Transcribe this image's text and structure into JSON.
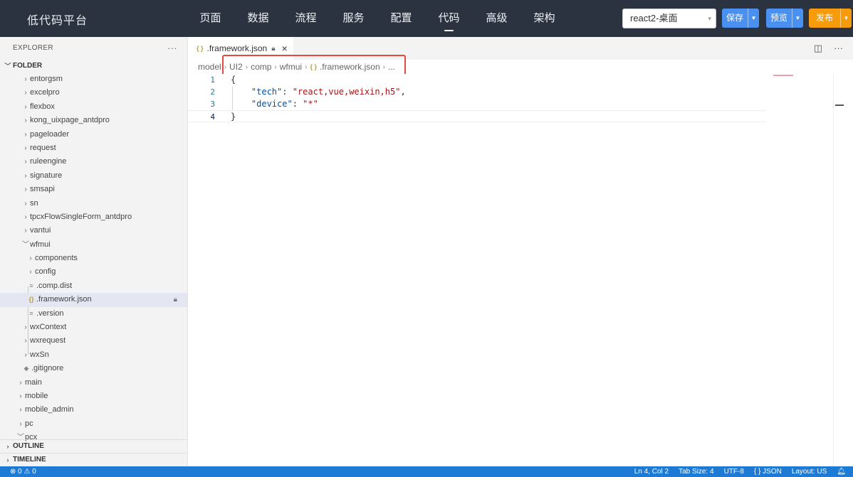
{
  "brand": "低代码平台",
  "nav": [
    "页面",
    "数据",
    "流程",
    "服务",
    "配置",
    "代码",
    "高级",
    "架构"
  ],
  "nav_active": "代码",
  "target_select": "react2-桌面",
  "buttons": {
    "save": "保存",
    "preview": "预览",
    "publish": "发布"
  },
  "explorer": {
    "title": "EXPLORER",
    "more": "···",
    "folder_label": "FOLDER",
    "outline_label": "OUTLINE",
    "timeline_label": "TIMELINE",
    "tree": [
      {
        "label": "entorgsm",
        "indent": 2,
        "kind": "folder"
      },
      {
        "label": "excelpro",
        "indent": 2,
        "kind": "folder"
      },
      {
        "label": "flexbox",
        "indent": 2,
        "kind": "folder"
      },
      {
        "label": "kong_uixpage_antdpro",
        "indent": 2,
        "kind": "folder"
      },
      {
        "label": "pageloader",
        "indent": 2,
        "kind": "folder"
      },
      {
        "label": "request",
        "indent": 2,
        "kind": "folder"
      },
      {
        "label": "ruleengine",
        "indent": 2,
        "kind": "folder"
      },
      {
        "label": "signature",
        "indent": 2,
        "kind": "folder"
      },
      {
        "label": "smsapi",
        "indent": 2,
        "kind": "folder"
      },
      {
        "label": "sn",
        "indent": 2,
        "kind": "folder"
      },
      {
        "label": "tpcxFlowSingleForm_antdpro",
        "indent": 2,
        "kind": "folder"
      },
      {
        "label": "vantui",
        "indent": 2,
        "kind": "folder"
      },
      {
        "label": "wfmui",
        "indent": 2,
        "kind": "folder-open"
      },
      {
        "label": "components",
        "indent": 3,
        "kind": "folder"
      },
      {
        "label": "config",
        "indent": 3,
        "kind": "folder"
      },
      {
        "label": ".comp.dist",
        "indent": 3,
        "kind": "file"
      },
      {
        "label": ".framework.json",
        "indent": 3,
        "kind": "json",
        "selected": true,
        "locked": true
      },
      {
        "label": ".version",
        "indent": 3,
        "kind": "file"
      },
      {
        "label": "wxContext",
        "indent": 2,
        "kind": "folder"
      },
      {
        "label": "wxrequest",
        "indent": 2,
        "kind": "folder"
      },
      {
        "label": "wxSn",
        "indent": 2,
        "kind": "folder"
      },
      {
        "label": ".gitignore",
        "indent": 2,
        "kind": "git"
      },
      {
        "label": "main",
        "indent": 1,
        "kind": "folder"
      },
      {
        "label": "mobile",
        "indent": 1,
        "kind": "folder"
      },
      {
        "label": "mobile_admin",
        "indent": 1,
        "kind": "folder"
      },
      {
        "label": "pc",
        "indent": 1,
        "kind": "folder"
      },
      {
        "label": "pcx",
        "indent": 1,
        "kind": "folder-open"
      }
    ]
  },
  "editor": {
    "tab_label": ".framework.json",
    "breadcrumb": [
      "model",
      "UI2",
      "comp",
      "wfmui",
      ".framework.json",
      "..."
    ],
    "lines": [
      {
        "num": "1",
        "text": "{"
      },
      {
        "num": "2",
        "key": "\"tech\"",
        "value": "\"react,vue,weixin,h5\"",
        "trail": ","
      },
      {
        "num": "3",
        "key": "\"device\"",
        "value": "\"*\"",
        "trail": ""
      },
      {
        "num": "4",
        "text": "}"
      }
    ]
  },
  "status": {
    "problems": "⊗ 0 ⚠ 0",
    "position": "Ln 4, Col 2",
    "tab_size": "Tab Size: 4",
    "encoding": "UTF-8",
    "language": "{ } JSON",
    "layout": "Layout: US"
  }
}
